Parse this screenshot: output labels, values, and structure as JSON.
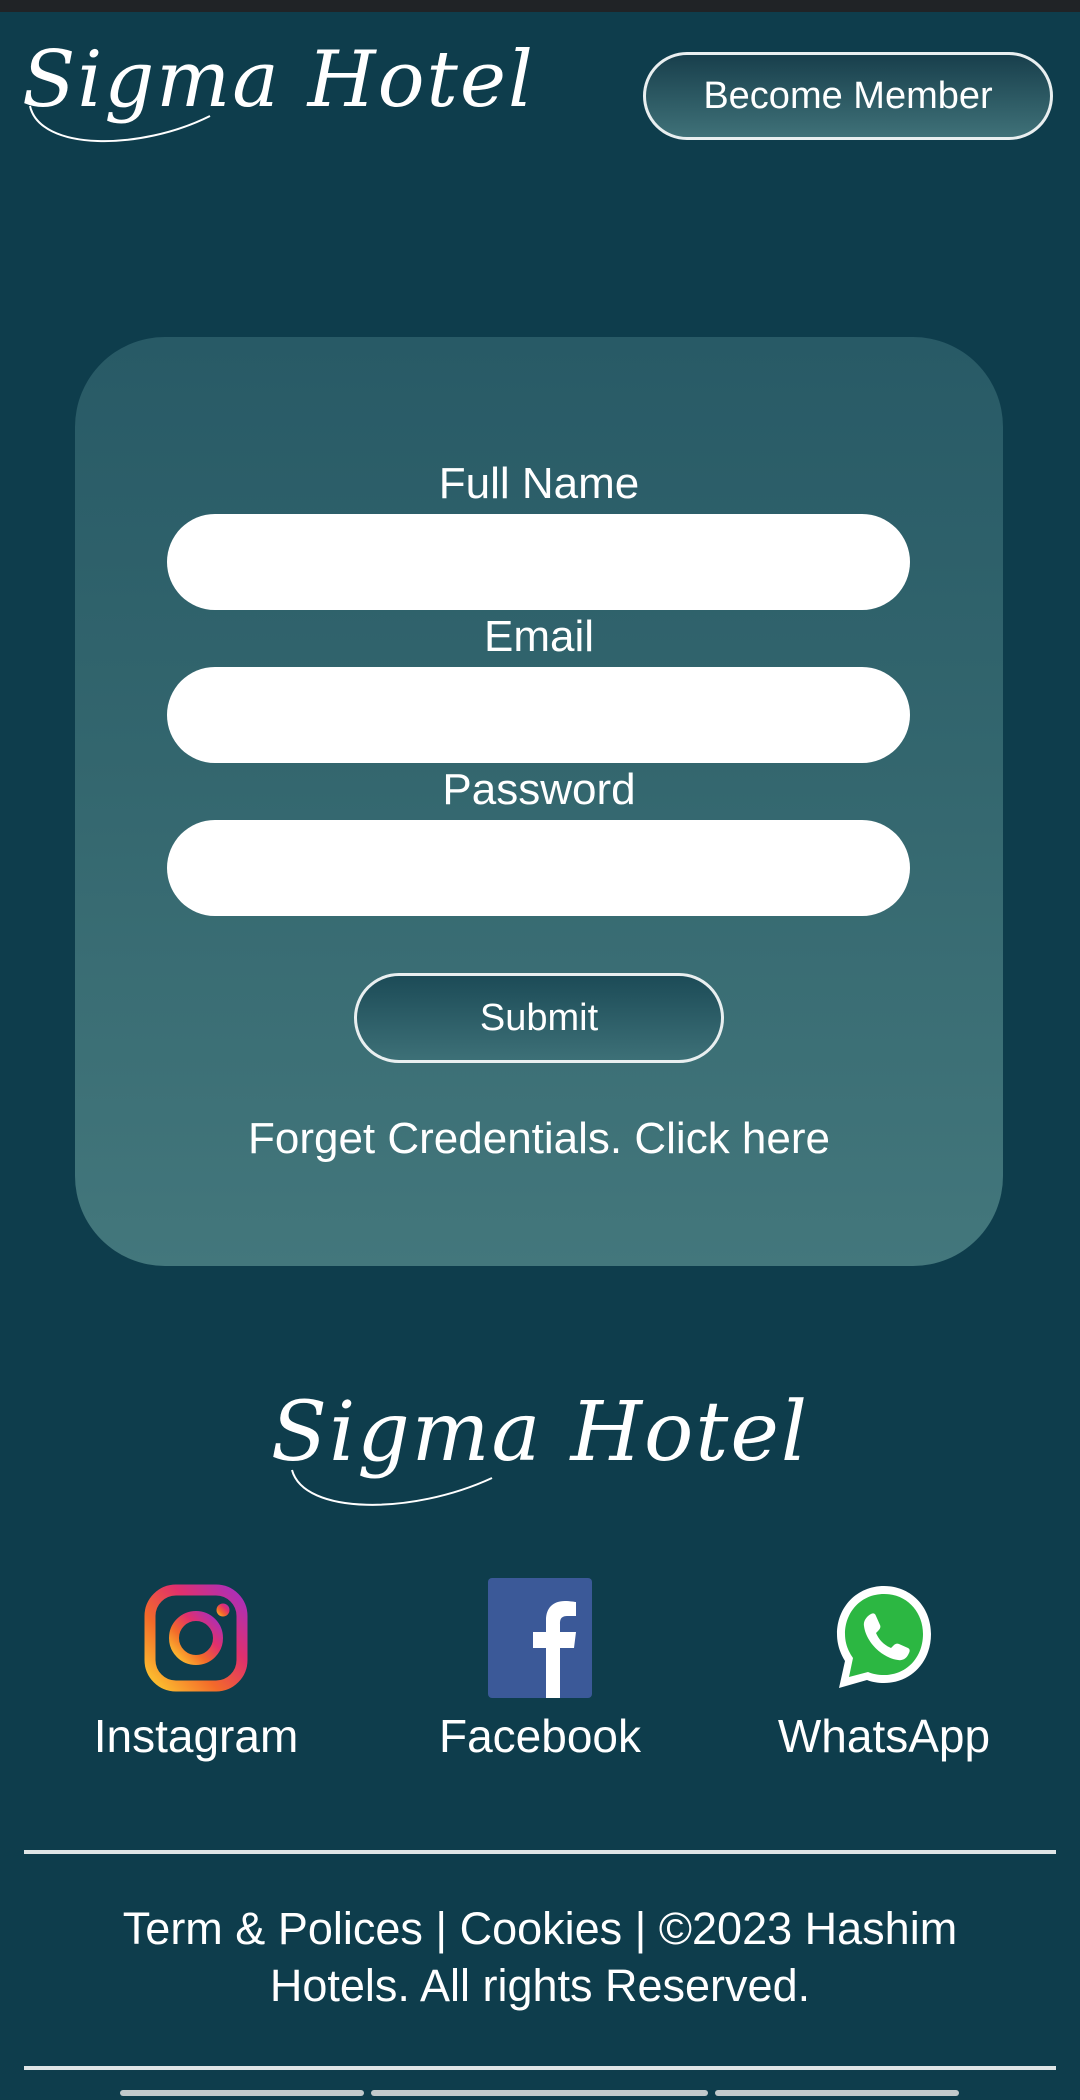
{
  "brand": {
    "name": "Sigma Hotel"
  },
  "header": {
    "become_member_label": "Become Member"
  },
  "form": {
    "full_name": {
      "label": "Full Name",
      "value": ""
    },
    "email": {
      "label": "Email",
      "value": ""
    },
    "password": {
      "label": "Password",
      "value": ""
    },
    "submit_label": "Submit",
    "forget_text": "Forget Credentials. Click here"
  },
  "social": [
    {
      "label": "Instagram",
      "icon": "instagram-icon"
    },
    {
      "label": "Facebook",
      "icon": "facebook-icon"
    },
    {
      "label": "WhatsApp",
      "icon": "whatsapp-icon"
    }
  ],
  "footer": {
    "terms": "Term & Polices",
    "separator": " | ",
    "cookies": "Cookies",
    "copyright": "©2023 Hashim Hotels. All rights Reserved."
  },
  "colors": {
    "background": "#0e3d4c",
    "card_top": "#285a66",
    "card_bottom": "#43777c",
    "facebook_blue": "#3b5998",
    "whatsapp_green": "#2cb742"
  }
}
